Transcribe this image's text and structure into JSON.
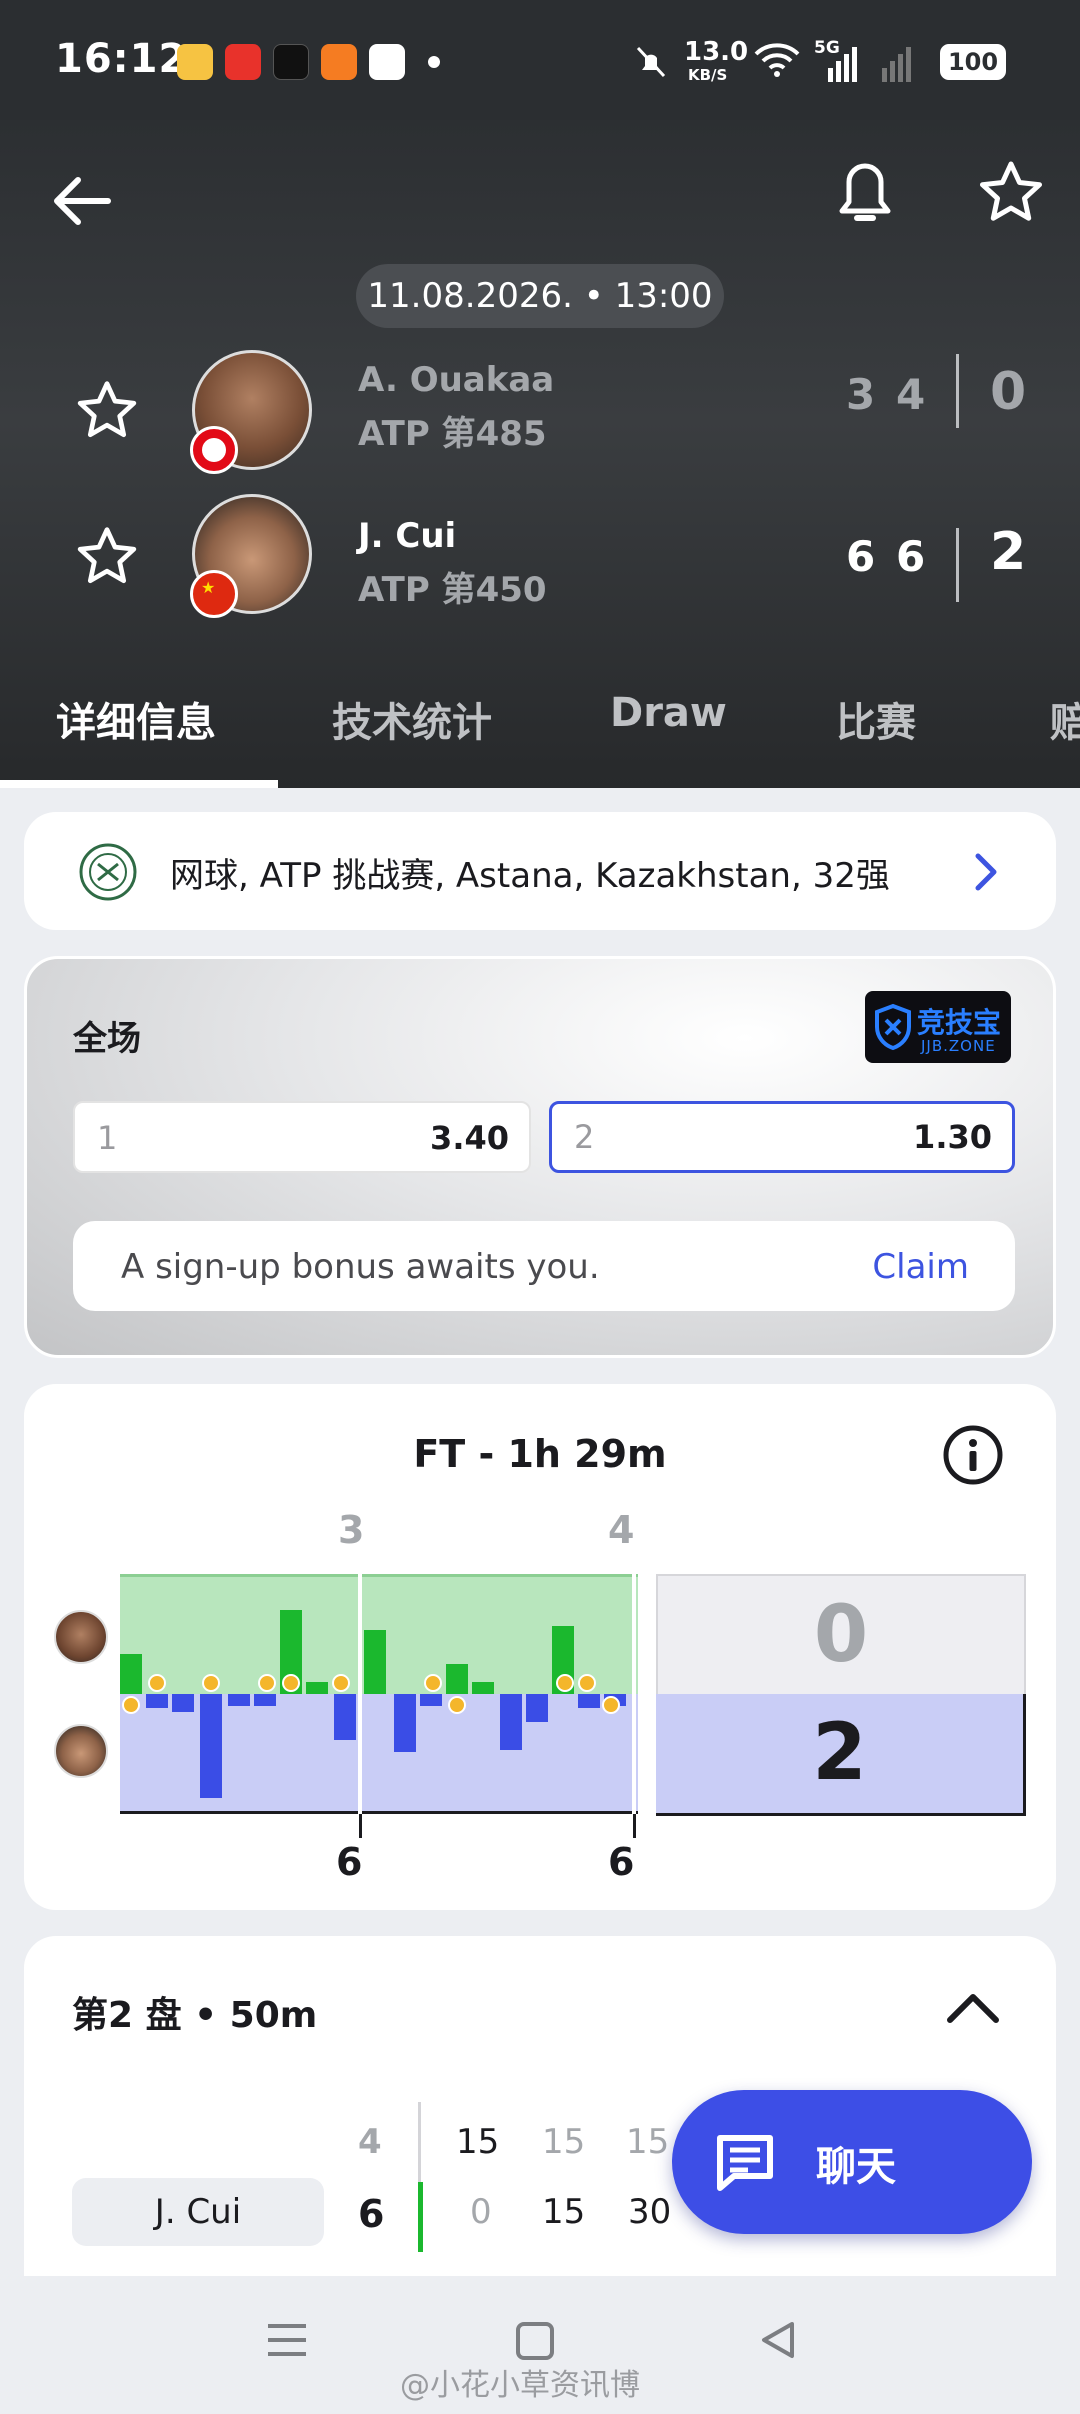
{
  "status_bar": {
    "time": "16:12",
    "net_speed_value": "13.0",
    "net_speed_unit": "KB/S",
    "signal": "5G",
    "battery": "100"
  },
  "header": {
    "datetime": "11.08.2026. • 13:00"
  },
  "players": [
    {
      "name": "A. Ouakaa",
      "rank": "ATP 第485",
      "games": [
        "3",
        "4"
      ],
      "sets": "0"
    },
    {
      "name": "J. Cui",
      "rank": "ATP 第450",
      "games": [
        "6",
        "6"
      ],
      "sets": "2"
    }
  ],
  "tabs": [
    "详细信息",
    "技术统计",
    "Draw",
    "比赛",
    "赔"
  ],
  "tournament": {
    "text": "网球, ATP 挑战赛, Astana, Kazakhstan, 32强"
  },
  "odds": {
    "title": "全场",
    "brand": "竞技宝",
    "brand_sub": "JJB.ZONE",
    "options": [
      {
        "label": "1",
        "value": "3.40"
      },
      {
        "label": "2",
        "value": "1.30"
      }
    ],
    "bonus_text": "A sign-up bonus awaits you.",
    "claim": "Claim"
  },
  "momentum": {
    "title": "FT - 1h 29m",
    "top_labels": [
      "3",
      "4"
    ],
    "bottom_labels": [
      "6",
      "6"
    ],
    "score_top": "0",
    "score_bottom": "2"
  },
  "set2": {
    "title": "第2 盘 • 50m",
    "top_games": "4",
    "top_points": [
      "15",
      "15",
      "15"
    ],
    "player": "J. Cui",
    "bottom_games": "6",
    "bottom_points": [
      "0",
      "15",
      "30"
    ]
  },
  "chat": {
    "label": "聊天"
  },
  "watermark": "@小花小草资讯博"
}
